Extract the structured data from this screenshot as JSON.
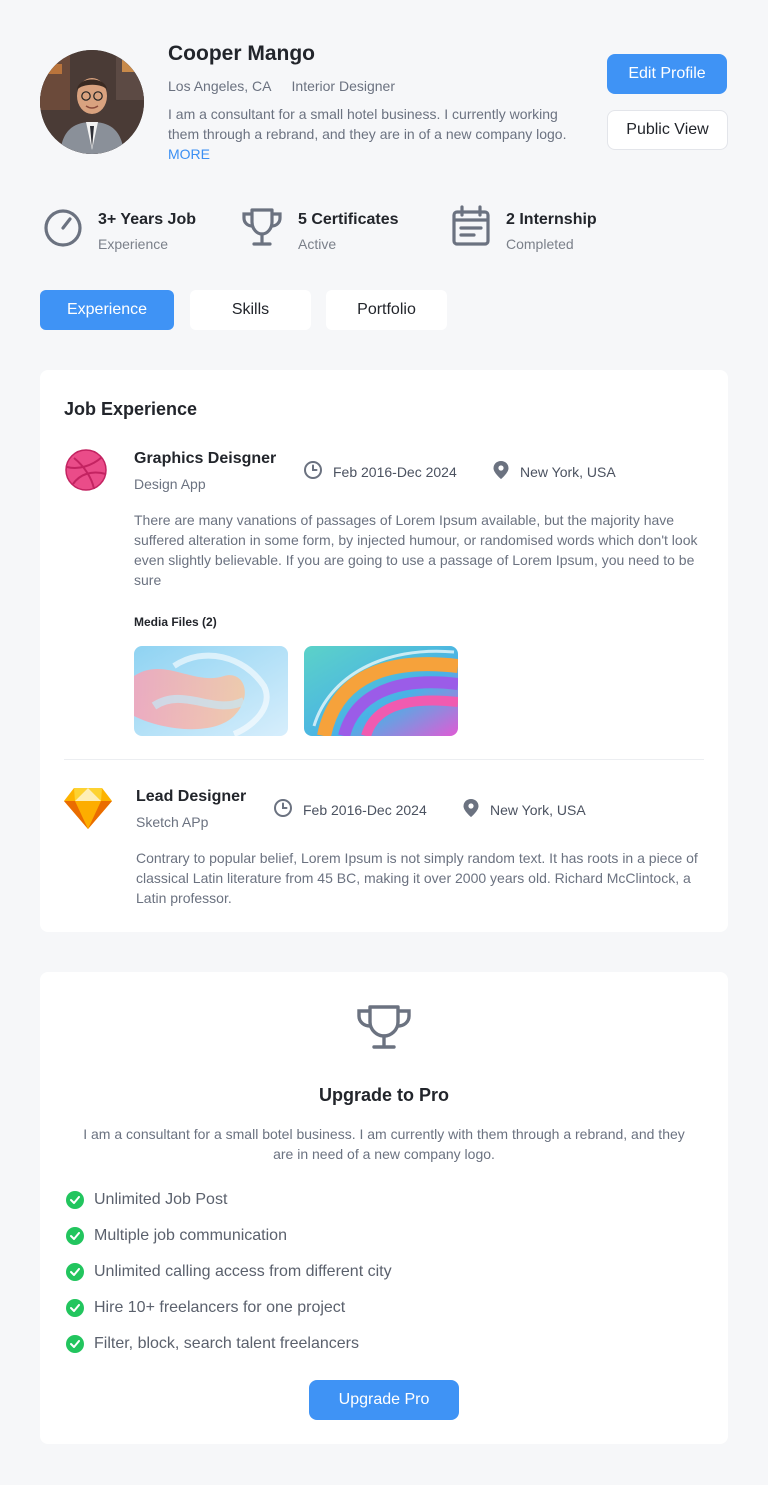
{
  "profile": {
    "name": "Cooper Mango",
    "location": "Los Angeles, CA",
    "role": "Interior Designer",
    "bio": "I am a consultant for a small hotel business. I currently working them through a rebrand, and they are in of a new company logo.",
    "more_label": "MORE"
  },
  "actions": {
    "edit_label": "Edit Profile",
    "public_label": "Public View"
  },
  "stats": [
    {
      "title": "3+ Years Job",
      "subtitle": "Experience",
      "icon": "gauge-icon"
    },
    {
      "title": "5 Certificates",
      "subtitle": "Active",
      "icon": "trophy-icon"
    },
    {
      "title": "2 Internship",
      "subtitle": "Completed",
      "icon": "calendar-icon"
    }
  ],
  "tabs": [
    {
      "label": "Experience",
      "active": true
    },
    {
      "label": "Skills",
      "active": false
    },
    {
      "label": "Portfolio",
      "active": false
    }
  ],
  "experience": {
    "heading": "Job Experience",
    "jobs": [
      {
        "title": "Graphics Deisgner",
        "company": "Design App",
        "dates": "Feb 2016-Dec 2024",
        "location": "New York, USA",
        "description": "There are many vanations of passages of Lorem Ipsum available, but the majority have suffered alteration in some form, by injected humour, or randomised words which don't look even slightly believable. If you are going to use a passage of Lorem Ipsum, you need to be sure",
        "media_label": "Media Files (2)",
        "logo": "dribbble-icon"
      },
      {
        "title": "Lead Designer",
        "company": "Sketch APp",
        "dates": "Feb 2016-Dec 2024",
        "location": "New York, USA",
        "description": "Contrary to popular belief, Lorem Ipsum is not simply random text. It has roots in a piece of classical Latin literature from 45 BC, making it over 2000 years old. Richard McClintock, a Latin professor.",
        "logo": "sketch-icon"
      }
    ]
  },
  "pro": {
    "title": "Upgrade to Pro",
    "description": "I am a consultant for a small botel business. I am currently with them through a rebrand, and they are in need of a new company logo.",
    "features": [
      "Unlimited Job Post",
      "Multiple job communication",
      "Unlimited calling access from different city",
      "Hire 10+ freelancers for one project",
      "Filter, block, search talent freelancers"
    ],
    "button_label": "Upgrade Pro"
  },
  "colors": {
    "accent": "#3f93f5",
    "success": "#22c55e",
    "background": "#f6f7f9"
  }
}
